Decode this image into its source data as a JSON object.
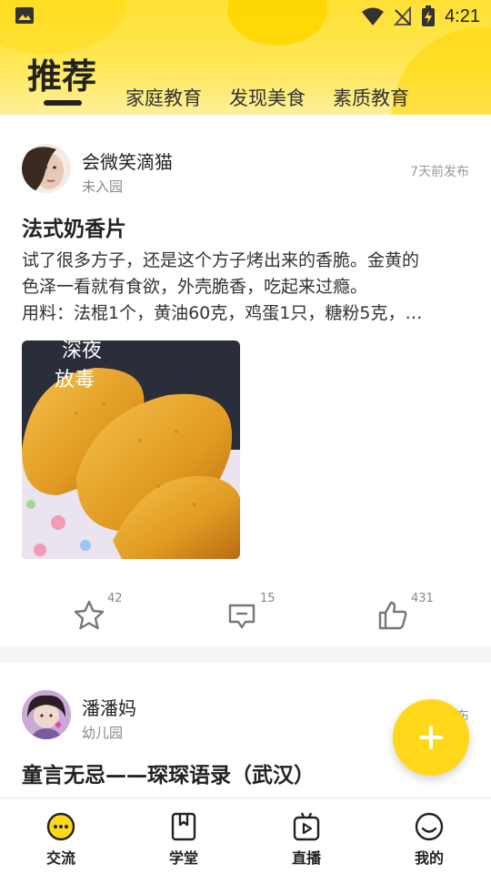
{
  "status_bar": {
    "time": "4:21"
  },
  "tabs": [
    {
      "label": "推荐",
      "active": true
    },
    {
      "label": "家庭教育",
      "active": false
    },
    {
      "label": "发现美食",
      "active": false
    },
    {
      "label": "素质教育",
      "active": false
    }
  ],
  "posts": [
    {
      "author": "会微笑滴猫",
      "sub": "未入园",
      "date": "7天前发布",
      "title": "法式奶香片",
      "body_lines": [
        "试了很多方子，还是这个方子烤出来的香脆。金黄的",
        "色泽一看就有食欲，外壳脆香，吃起来过瘾。",
        "用料：法棍1个，黄油60克，鸡蛋1只，糖粉5克，…"
      ],
      "photo_watermark": [
        "深夜",
        "放毒"
      ],
      "favorites": "42",
      "comments": "15",
      "likes": "431"
    },
    {
      "author": "潘潘妈",
      "sub": "幼儿园",
      "date_partial": "布",
      "title": "童言无忌——琛琛语录（武汉）"
    }
  ],
  "bottom_nav": [
    {
      "label": "交流",
      "icon": "chat-icon",
      "active": true
    },
    {
      "label": "学堂",
      "icon": "book-icon",
      "active": false
    },
    {
      "label": "直播",
      "icon": "live-tv-icon",
      "active": false
    },
    {
      "label": "我的",
      "icon": "smile-icon",
      "active": false
    }
  ],
  "colors": {
    "accent": "#ffd81a",
    "header_bg": "#ffe033"
  }
}
